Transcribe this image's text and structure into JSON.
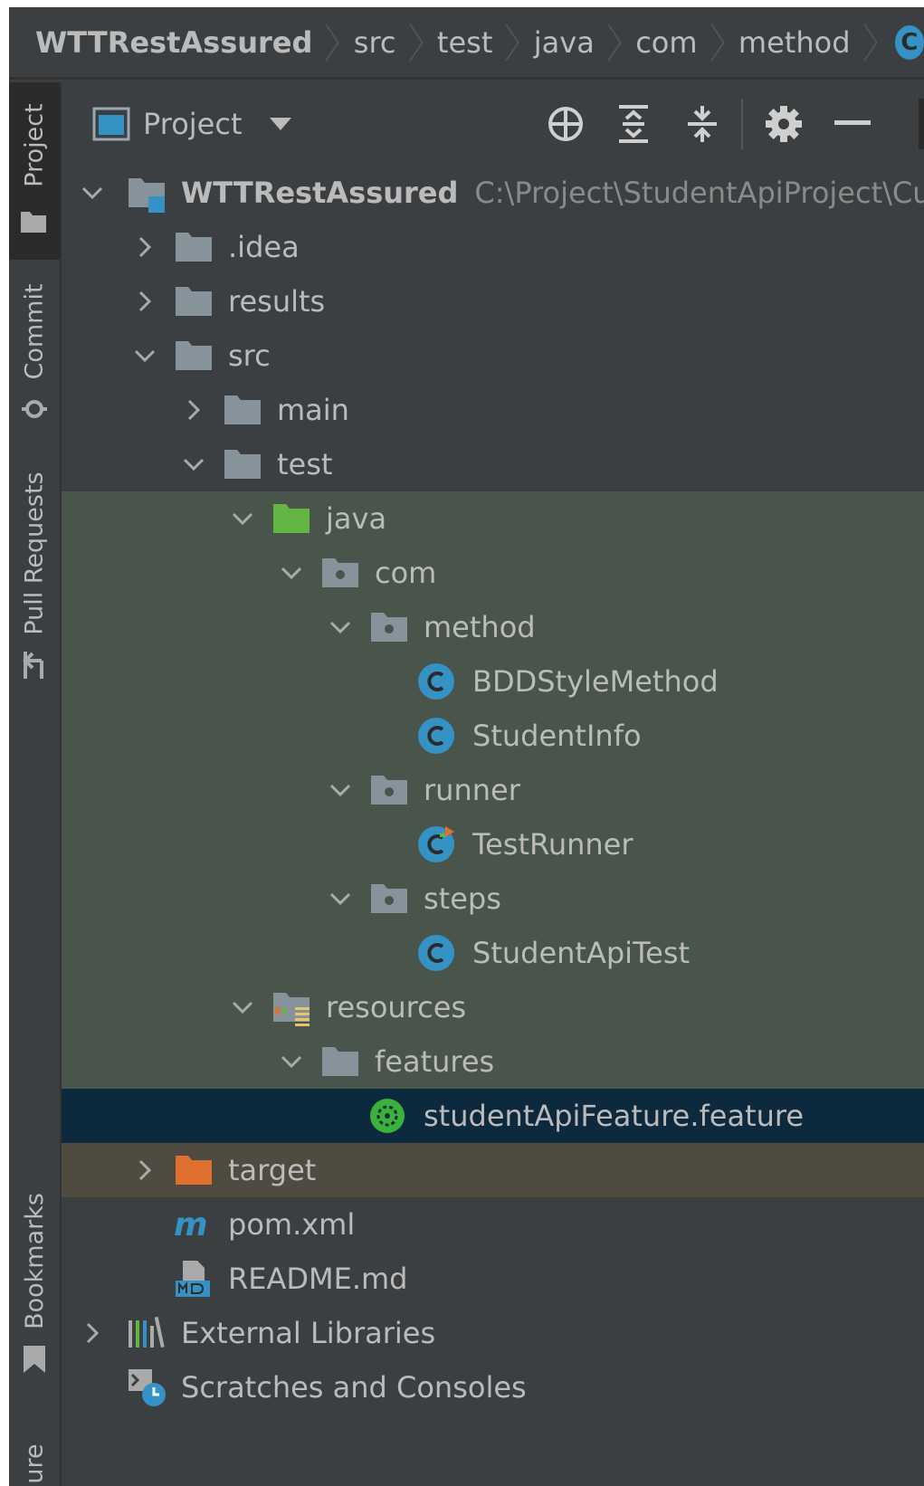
{
  "breadcrumb": [
    "WTTRestAssured",
    "src",
    "test",
    "java",
    "com",
    "method"
  ],
  "breadcrumb_class_icon": "C",
  "stripe": {
    "project": "Project",
    "commit": "Commit",
    "pull_requests": "Pull Requests",
    "bookmarks": "Bookmarks",
    "structure": "ure"
  },
  "toolbar": {
    "view_selector": "Project"
  },
  "tree": {
    "root": "WTTRestAssured",
    "root_path": "C:\\Project\\StudentApiProject\\Cu",
    "idea": ".idea",
    "results": "results",
    "src": "src",
    "main": "main",
    "test": "test",
    "java": "java",
    "com": "com",
    "method": "method",
    "bdd": "BDDStyleMethod",
    "studentinfo": "StudentInfo",
    "runner": "runner",
    "testrunner": "TestRunner",
    "steps": "steps",
    "studentapitest": "StudentApiTest",
    "resources": "resources",
    "features": "features",
    "feature_file": "studentApiFeature.feature",
    "target": "target",
    "pom": "pom.xml",
    "readme": "README.md",
    "external": "External Libraries",
    "scratches": "Scratches and Consoles"
  },
  "colors": {
    "background": "#3c3f41",
    "selected_row": "#0d293e",
    "source_root_highlight": "#49544a",
    "excluded_highlight": "#4f4b41",
    "folder": "#87939a",
    "source_folder": "#62b543",
    "excluded_folder": "#e07030",
    "class_icon": "#3592c4",
    "text": "#bbbbbb"
  }
}
